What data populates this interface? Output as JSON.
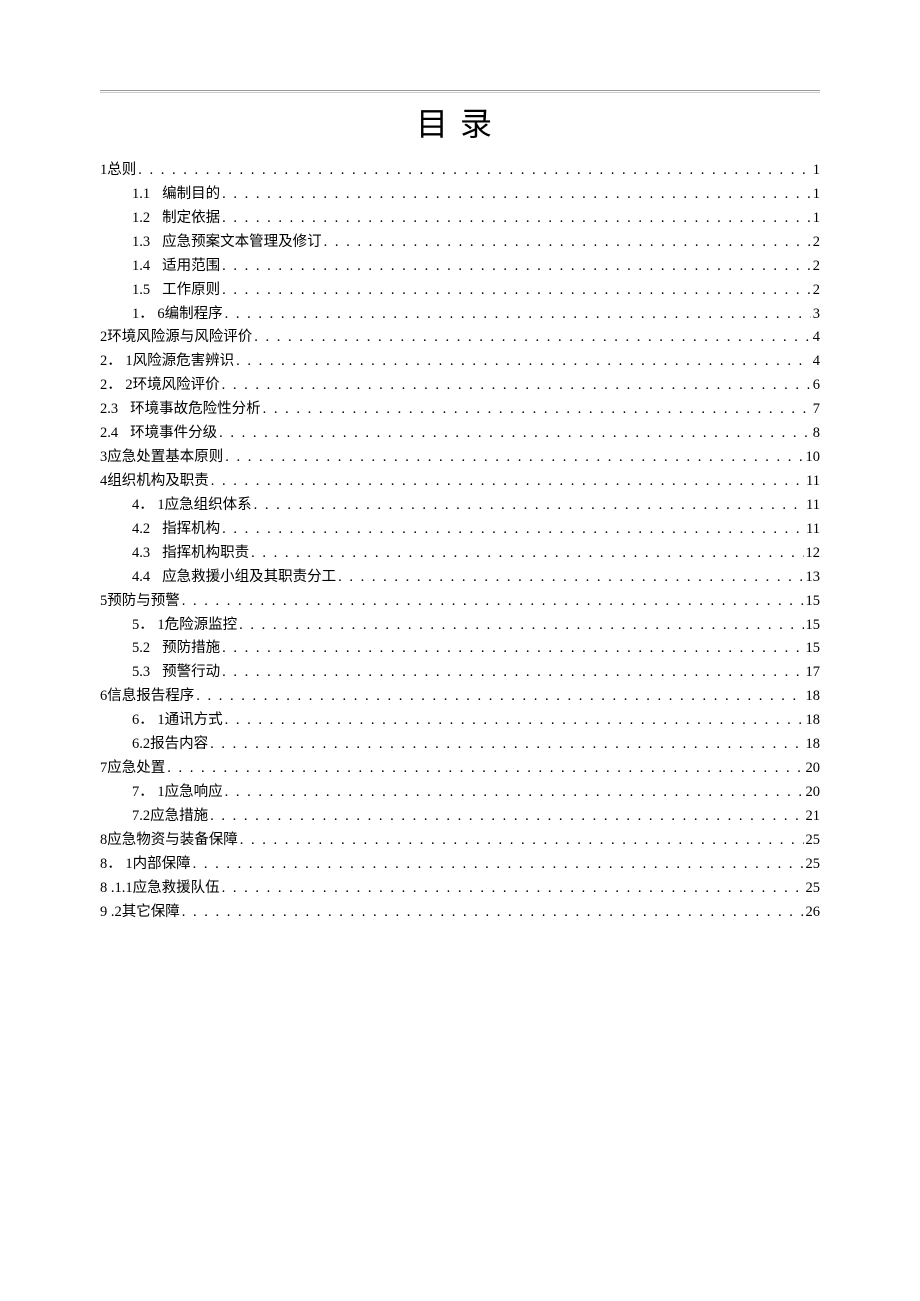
{
  "title": "目录",
  "toc": [
    {
      "level": 0,
      "num": "1",
      "text": "总则",
      "page": "1"
    },
    {
      "level": 1,
      "num": "1.1",
      "text": "编制目的",
      "page": "1",
      "gap": true
    },
    {
      "level": 1,
      "num": "1.2",
      "text": "制定依据",
      "page": "1",
      "gap": true
    },
    {
      "level": 1,
      "num": "1.3",
      "text": "应急预案文本管理及修订",
      "page": "2",
      "gap": true
    },
    {
      "level": 1,
      "num": "1.4",
      "text": "适用范围",
      "page": "2",
      "gap": true
    },
    {
      "level": 1,
      "num": "1.5",
      "text": "工作原则",
      "page": "2",
      "gap": true
    },
    {
      "level": 1,
      "num": "1． 6",
      "text": "编制程序",
      "page": "3"
    },
    {
      "level": 0,
      "num": "2",
      "text": "环境风险源与风险评价",
      "page": "4"
    },
    {
      "level": 0,
      "num": "2． 1",
      "text": "风险源危害辨识",
      "page": "4"
    },
    {
      "level": 0,
      "num": "2． 2",
      "text": "环境风险评价",
      "page": "6"
    },
    {
      "level": 0,
      "num": "2.3",
      "text": "环境事故危险性分析",
      "page": "7",
      "gap": true
    },
    {
      "level": 0,
      "num": "2.4",
      "text": "环境事件分级",
      "page": "8",
      "gap": true
    },
    {
      "level": 0,
      "num": "3",
      "text": "应急处置基本原则",
      "page": "10"
    },
    {
      "level": 0,
      "num": "4",
      "text": "组织机构及职责",
      "page": "11"
    },
    {
      "level": 1,
      "num": "4． 1",
      "text": "应急组织体系",
      "page": "11"
    },
    {
      "level": 1,
      "num": "4.2",
      "text": "指挥机构",
      "page": "11",
      "gap": true
    },
    {
      "level": 1,
      "num": "4.3",
      "text": "指挥机构职责",
      "page": "12",
      "gap": true
    },
    {
      "level": 1,
      "num": "4.4",
      "text": "应急救援小组及其职责分工",
      "page": "13",
      "gap": true
    },
    {
      "level": 0,
      "num": "5",
      "text": "预防与预警",
      "page": "15"
    },
    {
      "level": 1,
      "num": "5． 1",
      "text": "危险源监控",
      "page": "15"
    },
    {
      "level": 1,
      "num": "5.2",
      "text": "预防措施",
      "page": "15",
      "gap": true
    },
    {
      "level": 1,
      "num": "5.3",
      "text": "预警行动",
      "page": "17",
      "gap": true
    },
    {
      "level": 0,
      "num": "6",
      "text": "信息报告程序",
      "page": "18"
    },
    {
      "level": 1,
      "num": "6． 1",
      "text": "通讯方式",
      "page": "18"
    },
    {
      "level": 1,
      "num": "6.2",
      "text": "报告内容",
      "page": "18"
    },
    {
      "level": 0,
      "num": "7",
      "text": "应急处置",
      "page": "20"
    },
    {
      "level": 1,
      "num": "7． 1",
      "text": "应急响应",
      "page": "20"
    },
    {
      "level": 1,
      "num": "7.2",
      "text": "应急措施",
      "page": "21"
    },
    {
      "level": 0,
      "num": "8",
      "text": "应急物资与装备保障",
      "page": "25"
    },
    {
      "level": 0,
      "num": "8． 1",
      "text": "内部保障",
      "page": "25"
    },
    {
      "level": 0,
      "num": "8   .1.1",
      "text": "应急救援队伍",
      "page": "25"
    },
    {
      "level": 0,
      "num": "9   .2",
      "text": "其它保障",
      "page": "26"
    }
  ]
}
